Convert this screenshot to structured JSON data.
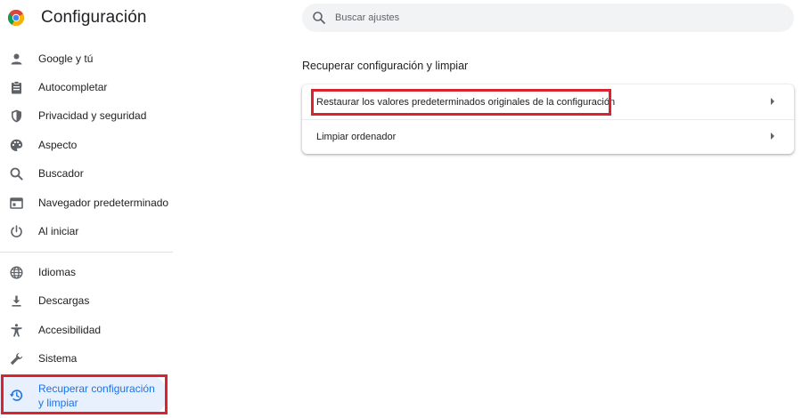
{
  "app": {
    "title": "Configuración",
    "logo_icon": "chrome-logo-icon"
  },
  "search": {
    "placeholder": "Buscar ajustes",
    "icon": "search-icon"
  },
  "sidebar": {
    "items": [
      {
        "label": "Google y tú",
        "icon": "person-icon"
      },
      {
        "label": "Autocompletar",
        "icon": "clipboard-icon"
      },
      {
        "label": "Privacidad y seguridad",
        "icon": "shield-icon"
      },
      {
        "label": "Aspecto",
        "icon": "palette-icon"
      },
      {
        "label": "Buscador",
        "icon": "search-icon"
      },
      {
        "label": "Navegador predeterminado",
        "icon": "browser-window-icon"
      },
      {
        "label": "Al iniciar",
        "icon": "power-icon"
      },
      {
        "label": "Idiomas",
        "icon": "globe-icon"
      },
      {
        "label": "Descargas",
        "icon": "download-icon"
      },
      {
        "label": "Accesibilidad",
        "icon": "accessibility-icon"
      },
      {
        "label": "Sistema",
        "icon": "wrench-icon"
      },
      {
        "label": "Recuperar configuración y limpiar",
        "icon": "history-icon",
        "active": true
      }
    ]
  },
  "main": {
    "section_title": "Recuperar configuración y limpiar",
    "rows": [
      {
        "label": "Restaurar los valores predeterminados originales de la configuración"
      },
      {
        "label": "Limpiar ordenador"
      }
    ]
  },
  "colors": {
    "accent": "#1a73e8",
    "active_bg": "#e8f0fe",
    "highlight": "#d9232e",
    "search_bg": "#f1f3f4"
  }
}
